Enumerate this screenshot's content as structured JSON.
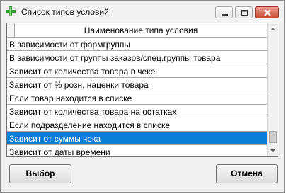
{
  "window": {
    "title": "Список типов условий"
  },
  "grid": {
    "column_header": "Наименование типа условия",
    "rows": [
      "В зависимости от фармгруппы",
      "В зависимости от группы заказов/спец.группы товара",
      "Зависит от количества товара в чеке",
      "Зависит от % розн. наценки товара",
      "Если товар находится в списке",
      "Зависит от количества товара на остатках",
      "Если подразделение находится в списке",
      "Зависит от суммы чека",
      "Зависит от даты времени"
    ],
    "selected_index": 7
  },
  "buttons": {
    "select_label": "Выбор",
    "cancel_label": "Отмена"
  },
  "colors": {
    "selection": "#0a7fd7",
    "app_icon": "#2f9e2f"
  }
}
